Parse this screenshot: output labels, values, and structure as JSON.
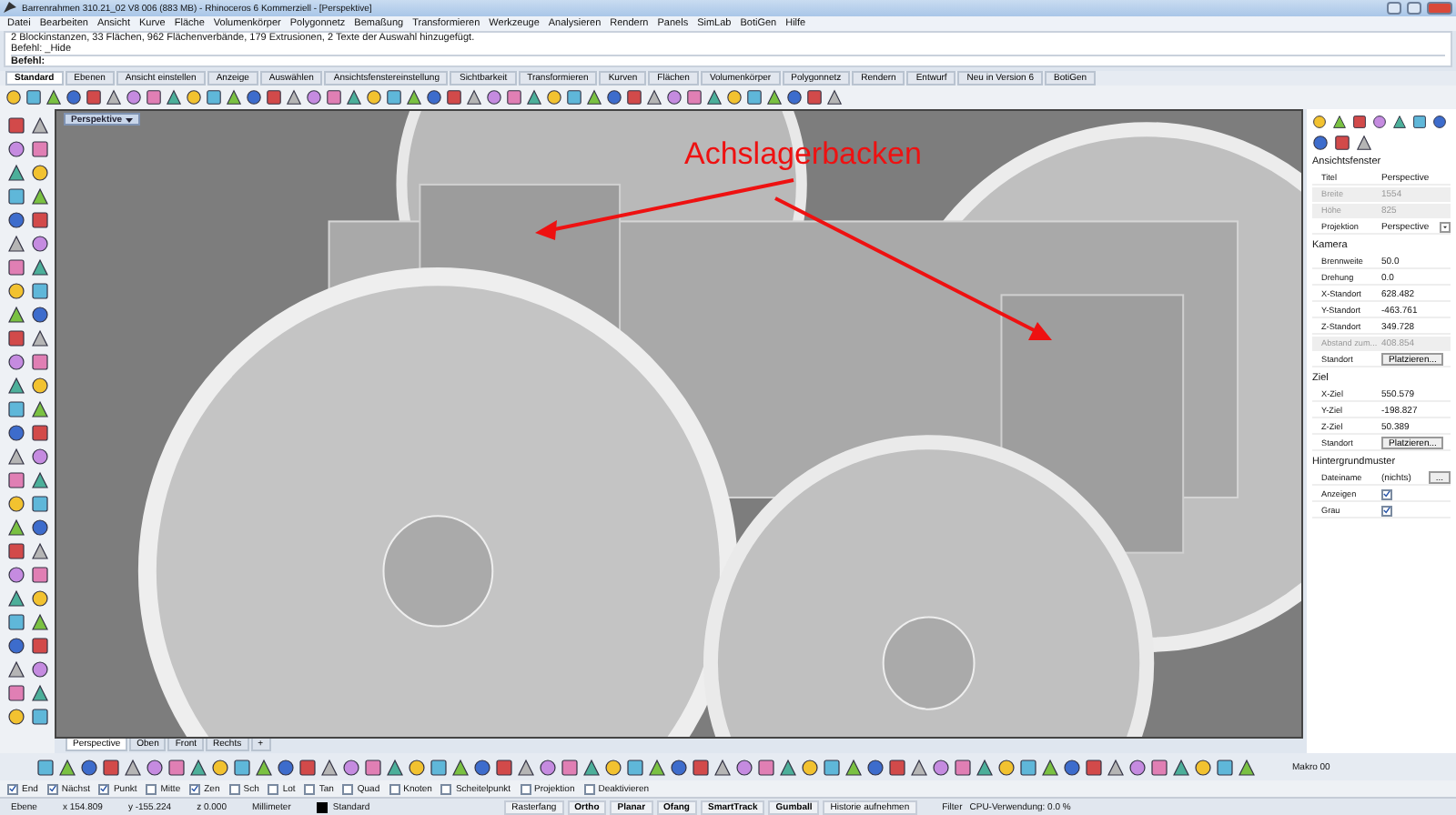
{
  "window": {
    "title": "Barrenrahmen 310.21_02 V8 006 (883 MB) - Rhinoceros 6 Kommerziell - [Perspektive]"
  },
  "menu": [
    "Datei",
    "Bearbeiten",
    "Ansicht",
    "Kurve",
    "Fläche",
    "Volumenkörper",
    "Polygonnetz",
    "Bemaßung",
    "Transformieren",
    "Werkzeuge",
    "Analysieren",
    "Rendern",
    "Panels",
    "SimLab",
    "BotiGen",
    "Hilfe"
  ],
  "command_history": [
    "2 Blockinstanzen, 33 Flächen, 962 Flächenverbände, 179 Extrusionen, 2 Texte der Auswahl hinzugefügt.",
    "Befehl: _Hide"
  ],
  "command_prompt": "Befehl:",
  "toolbar_tabs": [
    {
      "label": "Standard",
      "selected": true
    },
    {
      "label": "Ebenen",
      "selected": false
    },
    {
      "label": "Ansicht einstellen",
      "selected": false
    },
    {
      "label": "Anzeige",
      "selected": false
    },
    {
      "label": "Auswählen",
      "selected": false
    },
    {
      "label": "Ansichtsfenstereinstellung",
      "selected": false
    },
    {
      "label": "Sichtbarkeit",
      "selected": false
    },
    {
      "label": "Transformieren",
      "selected": false
    },
    {
      "label": "Kurven",
      "selected": false
    },
    {
      "label": "Flächen",
      "selected": false
    },
    {
      "label": "Volumenkörper",
      "selected": false
    },
    {
      "label": "Polygonnetz",
      "selected": false
    },
    {
      "label": "Rendern",
      "selected": false
    },
    {
      "label": "Entwurf",
      "selected": false
    },
    {
      "label": "Neu in Version 6",
      "selected": false
    },
    {
      "label": "BotiGen",
      "selected": false
    }
  ],
  "viewport": {
    "title": "Perspektive",
    "annotation": "Achslagerbacken"
  },
  "viewport_tabs": [
    {
      "label": "Perspective",
      "selected": true
    },
    {
      "label": "Oben",
      "selected": false
    },
    {
      "label": "Front",
      "selected": false
    },
    {
      "label": "Rechts",
      "selected": false
    }
  ],
  "add_viewport": "+",
  "macro_label": "Makro 00",
  "osnaps": [
    {
      "label": "End",
      "checked": true
    },
    {
      "label": "Nächst",
      "checked": true
    },
    {
      "label": "Punkt",
      "checked": true
    },
    {
      "label": "Mitte",
      "checked": false
    },
    {
      "label": "Zen",
      "checked": true
    },
    {
      "label": "Sch",
      "checked": false
    },
    {
      "label": "Lot",
      "checked": false
    },
    {
      "label": "Tan",
      "checked": false
    },
    {
      "label": "Quad",
      "checked": false
    },
    {
      "label": "Knoten",
      "checked": false
    },
    {
      "label": "Scheitelpunkt",
      "checked": false
    },
    {
      "label": "Projektion",
      "checked": false
    },
    {
      "label": "Deaktivieren",
      "checked": false
    }
  ],
  "status_bar": {
    "layer": "Ebene",
    "x": "x 154.809",
    "y": "y -155.224",
    "z": "z 0.000",
    "units": "Millimeter",
    "layer_name": "Standard",
    "toggles": [
      {
        "label": "Rasterfang",
        "on": false
      },
      {
        "label": "Ortho",
        "on": true
      },
      {
        "label": "Planar",
        "on": true
      },
      {
        "label": "Ofang",
        "on": true
      },
      {
        "label": "SmartTrack",
        "on": true
      },
      {
        "label": "Gumball",
        "on": true
      },
      {
        "label": "Historie aufnehmen",
        "on": false
      }
    ],
    "filter": "Filter",
    "cpu": "CPU-Verwendung: 0.0 %"
  },
  "properties": {
    "sections": [
      {
        "title": "Ansichtsfenster",
        "rows": [
          {
            "kind": "text",
            "label": "Titel",
            "value": "Perspective",
            "disabled": false
          },
          {
            "kind": "text",
            "label": "Breite",
            "value": "1554",
            "disabled": true
          },
          {
            "kind": "text",
            "label": "Höhe",
            "value": "825",
            "disabled": true
          },
          {
            "kind": "dropdown",
            "label": "Projektion",
            "value": "Perspective",
            "disabled": false
          }
        ]
      },
      {
        "title": "Kamera",
        "rows": [
          {
            "kind": "text",
            "label": "Brennweite",
            "value": "50.0",
            "disabled": false
          },
          {
            "kind": "text",
            "label": "Drehung",
            "value": "0.0",
            "disabled": false
          },
          {
            "kind": "text",
            "label": "X-Standort",
            "value": "628.482",
            "disabled": false
          },
          {
            "kind": "text",
            "label": "Y-Standort",
            "value": "-463.761",
            "disabled": false
          },
          {
            "kind": "text",
            "label": "Z-Standort",
            "value": "349.728",
            "disabled": false
          },
          {
            "kind": "text",
            "label": "Abstand zum...",
            "value": "408.854",
            "disabled": true
          },
          {
            "kind": "button",
            "label": "Standort",
            "value": "Platzieren...",
            "disabled": false
          }
        ]
      },
      {
        "title": "Ziel",
        "rows": [
          {
            "kind": "text",
            "label": "X-Ziel",
            "value": "550.579",
            "disabled": false
          },
          {
            "kind": "text",
            "label": "Y-Ziel",
            "value": "-198.827",
            "disabled": false
          },
          {
            "kind": "text",
            "label": "Z-Ziel",
            "value": "50.389",
            "disabled": false
          },
          {
            "kind": "button",
            "label": "Standort",
            "value": "Platzieren...",
            "disabled": false
          }
        ]
      },
      {
        "title": "Hintergrundmuster",
        "rows": [
          {
            "kind": "file",
            "label": "Dateiname",
            "value": "(nichts)",
            "browse": "...",
            "disabled": false
          },
          {
            "kind": "checkbox",
            "label": "Anzeigen",
            "checked": true,
            "disabled": false
          },
          {
            "kind": "checkbox",
            "label": "Grau",
            "checked": true,
            "disabled": false
          }
        ]
      }
    ]
  }
}
